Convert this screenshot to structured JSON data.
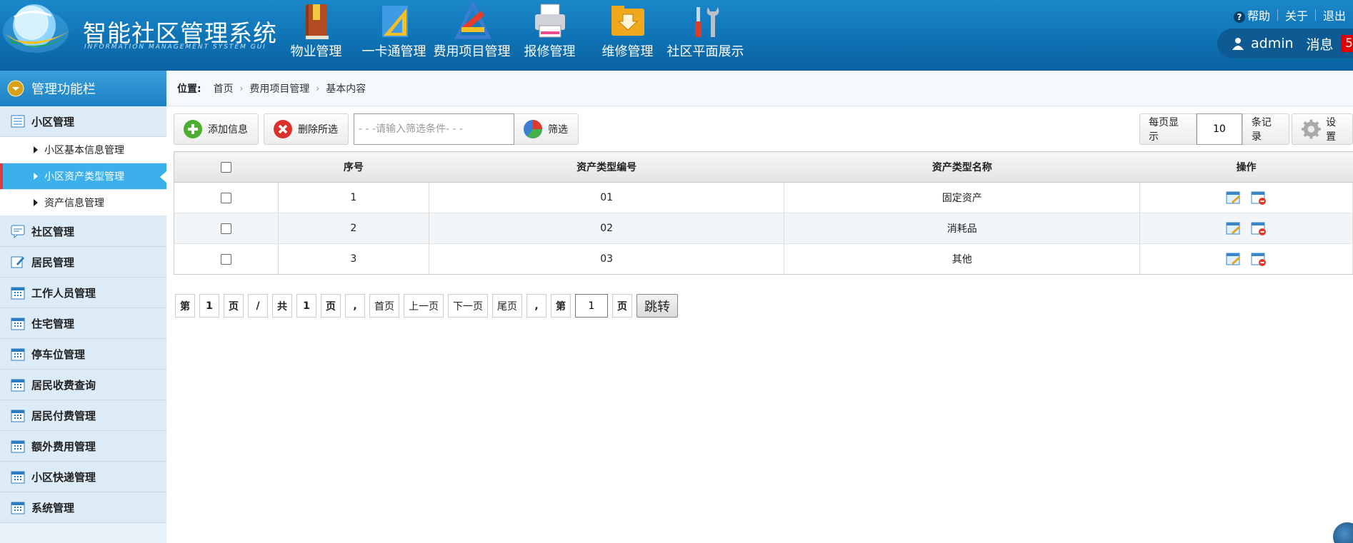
{
  "header": {
    "title": "智能社区管理系统",
    "subtitle": "INFORMATION MANAGEMENT SYSTEM GUI",
    "nav": [
      {
        "label": "物业管理",
        "icon": "book-icon"
      },
      {
        "label": "一卡通管理",
        "icon": "ruler-icon"
      },
      {
        "label": "费用项目管理",
        "icon": "pencil-ruler-icon"
      },
      {
        "label": "报修管理",
        "icon": "printer-icon"
      },
      {
        "label": "维修管理",
        "icon": "download-folder-icon"
      },
      {
        "label": "社区平面展示",
        "icon": "tools-icon"
      }
    ],
    "links": {
      "help": "帮助",
      "about": "关于",
      "logout": "退出"
    },
    "user": {
      "name": "admin",
      "msg_label": "消息",
      "msg_count": "5"
    }
  },
  "sidebar": {
    "heading": "管理功能栏",
    "groups": [
      {
        "label": "小区管理",
        "sub": [
          "小区基本信息管理",
          "小区资产类型管理",
          "资产信息管理"
        ],
        "active_sub": 1
      },
      {
        "label": "社区管理"
      },
      {
        "label": "居民管理"
      },
      {
        "label": "工作人员管理"
      },
      {
        "label": "住宅管理"
      },
      {
        "label": "停车位管理"
      },
      {
        "label": "居民收费查询"
      },
      {
        "label": "居民付费管理"
      },
      {
        "label": "额外费用管理"
      },
      {
        "label": "小区快递管理"
      },
      {
        "label": "系统管理"
      }
    ]
  },
  "breadcrumb": {
    "prefix": "位置:",
    "items": [
      "首页",
      "费用项目管理",
      "基本内容"
    ]
  },
  "toolbar": {
    "add_label": "添加信息",
    "delete_label": "删除所选",
    "filter_placeholder": "- - -请输入筛选条件- - -",
    "filter_label": "筛选",
    "per_page_label": "每页显示",
    "per_page_value": "10",
    "per_page_unit": "条记录",
    "settings_label": "设置"
  },
  "table": {
    "columns": [
      "",
      "序号",
      "资产类型编号",
      "资产类型名称",
      "操作"
    ],
    "rows": [
      {
        "no": "1",
        "code": "01",
        "name": "固定资产"
      },
      {
        "no": "2",
        "code": "02",
        "name": "消耗品"
      },
      {
        "no": "3",
        "code": "03",
        "name": "其他"
      }
    ]
  },
  "pager": {
    "t_di": "第",
    "page": "1",
    "t_ye": "页",
    "slash": "/",
    "t_gong": "共",
    "total": "1",
    "t_ye2": "页",
    "comma": ",",
    "first": "首页",
    "prev": "上一页",
    "next": "下一页",
    "last": "尾页",
    "comma2": ",",
    "t_di2": "第",
    "jump_value": "1",
    "t_ye3": "页",
    "go": "跳转"
  },
  "colors": {
    "header": "#0f73b5",
    "sidebar_active": "#3bb0ea",
    "badge": "#e00000"
  }
}
